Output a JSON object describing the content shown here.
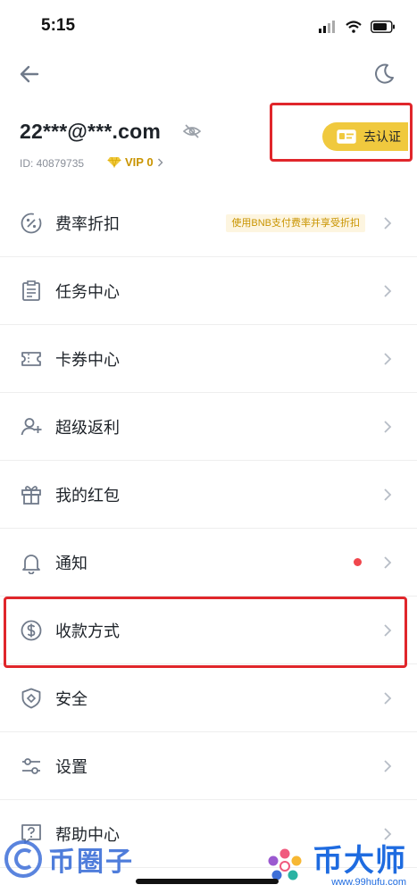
{
  "status_bar": {
    "time": "5:15"
  },
  "profile": {
    "email": "22***@***.com",
    "uid": "ID: 40879735",
    "vip": "VIP 0",
    "verify_label": "去认证"
  },
  "menu": {
    "items": [
      {
        "label": "费率折扣",
        "icon": "fee-discount-icon",
        "badge": "使用BNB支付费率并享受折扣"
      },
      {
        "label": "任务中心",
        "icon": "task-center-icon"
      },
      {
        "label": "卡券中心",
        "icon": "coupon-icon"
      },
      {
        "label": "超级返利",
        "icon": "referral-icon"
      },
      {
        "label": "我的红包",
        "icon": "gift-icon"
      },
      {
        "label": "通知",
        "icon": "bell-icon",
        "has_dot": true
      },
      {
        "label": "收款方式",
        "icon": "dollar-icon"
      },
      {
        "label": "安全",
        "icon": "shield-icon"
      },
      {
        "label": "设置",
        "icon": "settings-icon"
      },
      {
        "label": "帮助中心",
        "icon": "help-icon"
      }
    ]
  },
  "watermarks": {
    "left": "币圈子",
    "right": "币大师",
    "right_url": "www.99hufu.com"
  },
  "colors": {
    "accent": "#f0c93e",
    "vip_gold": "#c99400",
    "highlight_red": "#e0262b",
    "notify_dot": "#f0474d"
  }
}
